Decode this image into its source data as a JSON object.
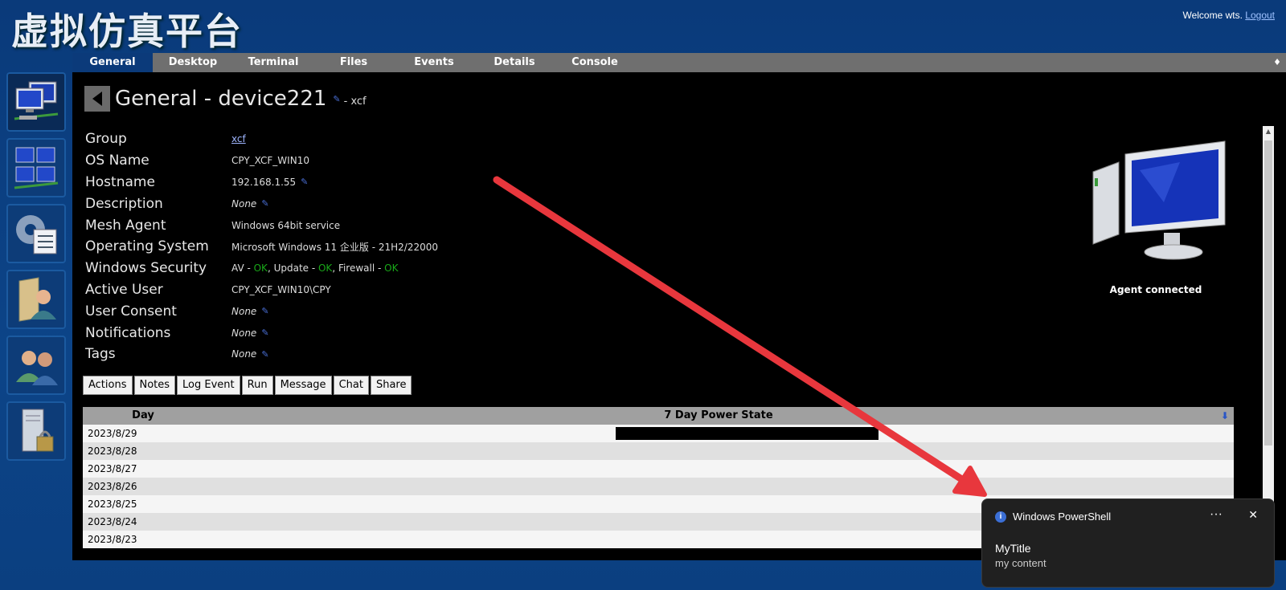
{
  "app": {
    "title": "虚拟仿真平台"
  },
  "header": {
    "welcome_text": "Welcome wts.",
    "logout_label": "Logout"
  },
  "tabs": [
    {
      "label": "General",
      "active": true
    },
    {
      "label": "Desktop"
    },
    {
      "label": "Terminal"
    },
    {
      "label": "Files"
    },
    {
      "label": "Events"
    },
    {
      "label": "Details"
    },
    {
      "label": "Console"
    }
  ],
  "tab_menu_icon": "diamond-icon",
  "sidebar": [
    {
      "icon": "devices-icon",
      "active": true
    },
    {
      "icon": "network-devices-icon"
    },
    {
      "icon": "settings-checklist-icon"
    },
    {
      "icon": "user-folder-icon"
    },
    {
      "icon": "users-icon"
    },
    {
      "icon": "server-lock-icon"
    }
  ],
  "page": {
    "title": "General - device221",
    "subtitle": "- xcf"
  },
  "properties": {
    "group": {
      "label": "Group",
      "value": "xcf"
    },
    "os_name": {
      "label": "OS Name",
      "value": "CPY_XCF_WIN10"
    },
    "hostname": {
      "label": "Hostname",
      "value": "192.168.1.55"
    },
    "description": {
      "label": "Description",
      "value": "None"
    },
    "mesh_agent": {
      "label": "Mesh Agent",
      "value": "Windows 64bit service"
    },
    "operating_system": {
      "label": "Operating System",
      "value": "Microsoft Windows 11 企业版 - 21H2/22000"
    },
    "windows_security": {
      "label": "Windows Security",
      "av_label": "AV - ",
      "av_status": "OK",
      "update_label": ", Update - ",
      "update_status": "OK",
      "firewall_label": ", Firewall - ",
      "firewall_status": "OK"
    },
    "active_user": {
      "label": "Active User",
      "value": "CPY_XCF_WIN10\\CPY"
    },
    "user_consent": {
      "label": "User Consent",
      "value": "None"
    },
    "notifications": {
      "label": "Notifications",
      "value": "None"
    },
    "tags": {
      "label": "Tags",
      "value": "None"
    }
  },
  "agent_status": "Agent connected",
  "actions": {
    "actions": "Actions",
    "notes": "Notes",
    "log_event": "Log Event",
    "run": "Run",
    "message": "Message",
    "chat": "Chat",
    "share": "Share"
  },
  "power_table": {
    "col_day": "Day",
    "col_state": "7 Day Power State",
    "rows": [
      {
        "day": "2023/8/29",
        "on_start_fraction": 0.4,
        "on_end_fraction": 0.655
      },
      {
        "day": "2023/8/28"
      },
      {
        "day": "2023/8/27"
      },
      {
        "day": "2023/8/26"
      },
      {
        "day": "2023/8/25"
      },
      {
        "day": "2023/8/24"
      },
      {
        "day": "2023/8/23"
      }
    ]
  },
  "toast": {
    "app": "Windows PowerShell",
    "title": "MyTitle",
    "content": "my content",
    "more": "···",
    "close": "✕"
  },
  "colors": {
    "ok": "#19a919",
    "arrow": "#e8373d",
    "toast_bg": "#202020"
  }
}
